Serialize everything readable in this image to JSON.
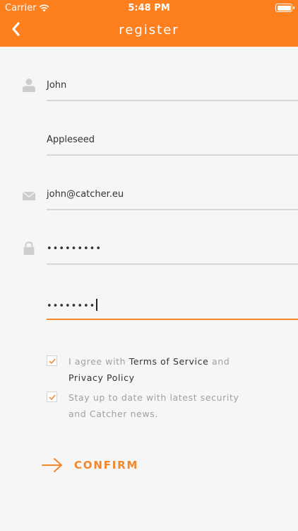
{
  "status_bar": {
    "carrier": "Carrier",
    "time": "5:48 PM"
  },
  "header": {
    "title": "register",
    "color": "#fe7f1d"
  },
  "form": {
    "first_name": "John",
    "last_name": "Appleseed",
    "email": "john@catcher.eu",
    "password": "•••••••••",
    "confirm_password": "••••••••"
  },
  "terms": {
    "checked": true,
    "prefix": "I agree with ",
    "tos_link": "Terms of Service",
    "middle": " and ",
    "privacy_link": "Privacy Policy"
  },
  "newsletter": {
    "checked": true,
    "text": "Stay up to date with latest security and Catcher news."
  },
  "confirm": {
    "label": "CONFIRM",
    "accent": "#f38629"
  },
  "icons": {
    "back": "chevron-left-icon",
    "user": "user-icon",
    "email": "envelope-icon",
    "password": "lock-icon",
    "confirm": "arrow-right-icon"
  }
}
